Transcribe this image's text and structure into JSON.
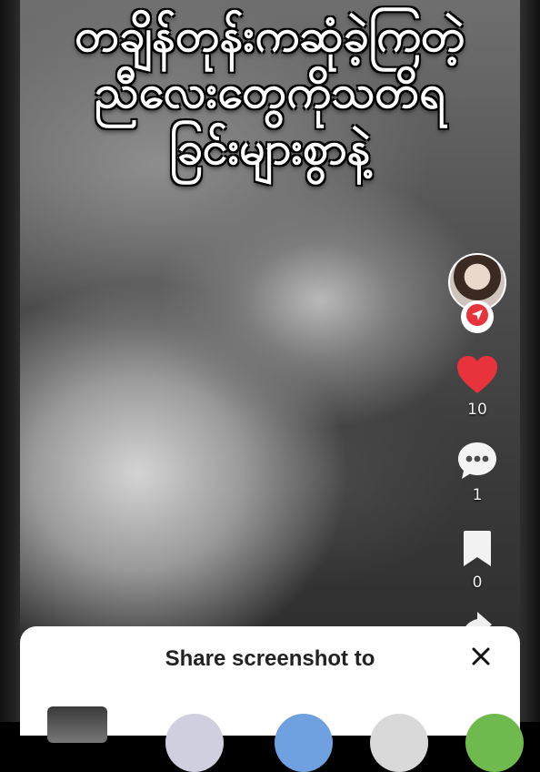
{
  "caption": {
    "lines": [
      "တချိန်တုန်းကဆုံခဲ့ကြတဲ့",
      "ညီလေးတွေကိုသတိရ",
      "ခြင်းများစွာနဲ့"
    ]
  },
  "rail": {
    "like_count": "10",
    "comment_count": "1",
    "bookmark_count": "0",
    "accent_color": "#e8323c"
  },
  "share_sheet": {
    "title": "Share screenshot to"
  }
}
